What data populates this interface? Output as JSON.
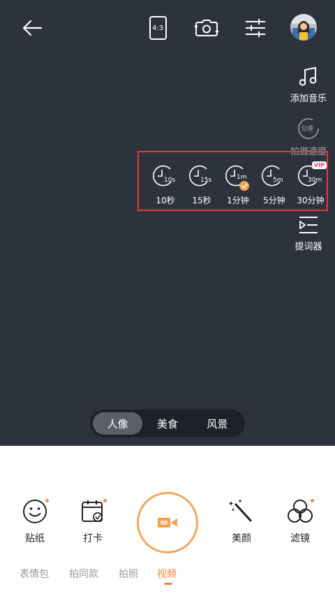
{
  "top_bar": {
    "ratio_label": "4:3",
    "icons": [
      "back-arrow-icon",
      "aspect-ratio-icon",
      "camera-flip-icon",
      "sliders-icon",
      "avatar"
    ]
  },
  "side_tools": {
    "music_label": "添加音乐",
    "speed_label": "拍摄速度",
    "speed_badge": "匀速",
    "teleprompter_label": "提词器"
  },
  "durations": [
    {
      "label": "10秒",
      "clock_sub": "10s"
    },
    {
      "label": "15秒",
      "clock_sub": "15s"
    },
    {
      "label": "1分钟",
      "clock_sub": "1m",
      "selected": true
    },
    {
      "label": "5分钟",
      "clock_sub": "5m"
    },
    {
      "label": "30分钟",
      "clock_sub": "30m",
      "badge": "VIP"
    }
  ],
  "scene_modes": [
    "人像",
    "美食",
    "风景"
  ],
  "active_scene": "人像",
  "tools": {
    "sticker_label": "贴纸",
    "checkin_label": "打卡",
    "beauty_label": "美颜",
    "filter_label": "滤镜"
  },
  "bottom_tabs": [
    "表情包",
    "拍同款",
    "拍照",
    "视频"
  ],
  "active_tab": "视频",
  "colors": {
    "accent": "#f2853d",
    "viewfinder_bg": "#2d333d",
    "highlight_border": "#e53935",
    "vip_text": "#e84a6a"
  }
}
